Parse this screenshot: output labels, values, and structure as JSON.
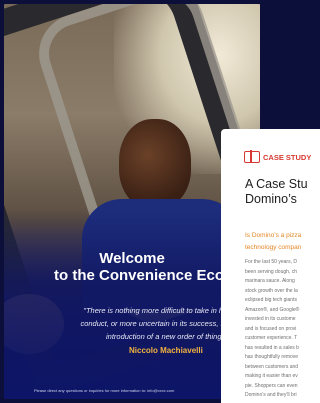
{
  "cover": {
    "welcome_line1": "Welcome",
    "welcome_line2": "to the Convenience Eco",
    "quote_line1": "\"There is nothing more difficult to take in hand, mor",
    "quote_line2": "conduct, or more uncertain in its success, than to tak",
    "quote_line3": "introduction of a new order of things.\"",
    "author": "Niccolo Machiavelli",
    "footnote": "Please direct any questions or inquiries for more information to: info@xxxx.com"
  },
  "card": {
    "label": "CASE STUDY",
    "title_line1": "A Case Stu",
    "title_line2": "Domino’s",
    "subtitle_line1": "Is Domino’s a pizza",
    "subtitle_line2": "technology compan",
    "body_lines": [
      "For the last 50 years, D",
      "been serving dough, ch",
      "marinara sauce. Along",
      "stock growth over the la",
      "eclipsed big tech giants",
      "Amazon®, and Google®",
      "invested in its custome",
      "and is focused on provi",
      "customer experience. T",
      "has resulted in a sales b",
      "has thoughtfully remove",
      "between customers and",
      "making it easier than ev",
      "pie. Shoppers can even",
      "Domino’s and they’ll bri"
    ]
  },
  "colors": {
    "background": "#0b0f3a",
    "accent_red": "#d63a32",
    "accent_orange": "#e48624",
    "author_gold": "#f3b340"
  },
  "icons": {
    "case_study": "book-icon"
  }
}
